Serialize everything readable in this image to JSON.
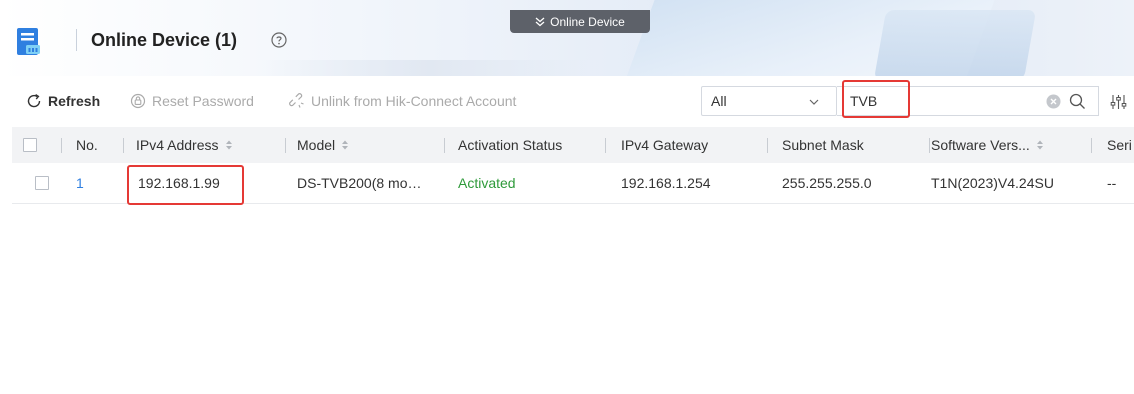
{
  "header": {
    "title": "Online Device (1)",
    "tab_label": "Online Device"
  },
  "toolbar": {
    "refresh_label": "Refresh",
    "reset_password_label": "Reset Password",
    "unlink_label": "Unlink from Hik-Connect Account",
    "filter_value": "All",
    "search_value": "TVB"
  },
  "table": {
    "columns": [
      "No.",
      "IPv4 Address",
      "Model",
      "Activation Status",
      "IPv4 Gateway",
      "Subnet Mask",
      "Software Vers...",
      "Seri"
    ],
    "rows": [
      {
        "no": "1",
        "ipv4": "192.168.1.99",
        "model": "DS-TVB200(8 mo…",
        "activation": "Activated",
        "gateway": "192.168.1.254",
        "subnet": "255.255.255.0",
        "software": "T1N(2023)V4.24SU",
        "serial": "--"
      }
    ]
  },
  "colors": {
    "accent_blue": "#2f7fe0",
    "activated_green": "#2e9a3a",
    "highlight_red": "#e53935",
    "tab_dark": "#5d6169"
  }
}
